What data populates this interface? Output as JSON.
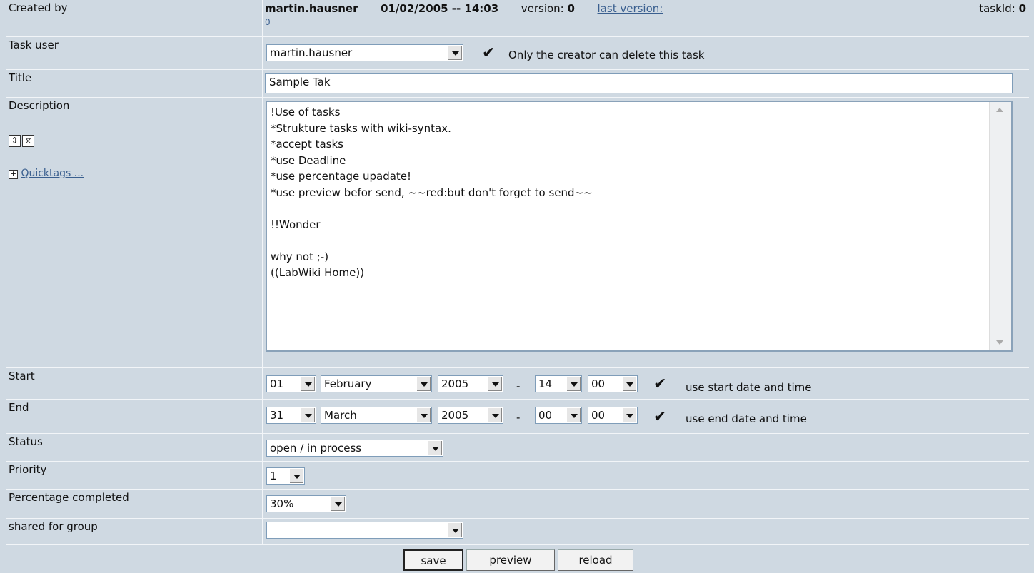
{
  "created": {
    "label": "Created by",
    "user": "martin.hausner",
    "datetime": "01/02/2005 -- 14:03",
    "version_label": "version:",
    "version_value": "0",
    "last_version_link": "last version:",
    "last_version_value": "0",
    "taskid_label": "taskId:",
    "taskid_value": "0"
  },
  "task_user": {
    "label": "Task user",
    "selected": "martin.hausner",
    "only_creator_label": "Only the creator can delete this task",
    "only_creator_checked": true
  },
  "title": {
    "label": "Title",
    "value": "Sample Tak"
  },
  "description": {
    "label": "Description",
    "quicktags_link": "Quicktags ...",
    "lines": [
      "!Use of tasks",
      "*Strukture tasks with wiki-syntax.",
      "*accept tasks",
      "*use Deadline",
      "*use percentage upadate!",
      "*use preview befor send, ~~red:but don't forget to send~~",
      "",
      "!!Wonder",
      "",
      "why not ;-)",
      "((LabWiki Home))"
    ]
  },
  "start": {
    "label": "Start",
    "day": "01",
    "month": "February",
    "year": "2005",
    "dash": "-",
    "hour": "14",
    "minute": "00",
    "use_label": "use start date and time",
    "checked": true
  },
  "end": {
    "label": "End",
    "day": "31",
    "month": "March",
    "year": "2005",
    "dash": "-",
    "hour": "00",
    "minute": "00",
    "use_label": "use end date and time",
    "checked": true
  },
  "status": {
    "label": "Status",
    "selected": "open / in process"
  },
  "priority": {
    "label": "Priority",
    "selected": "1"
  },
  "percentage": {
    "label": "Percentage completed",
    "selected": "30%"
  },
  "shared": {
    "label": "shared for group",
    "selected": ""
  },
  "buttons": {
    "save": "save",
    "preview": "preview",
    "reload": "reload"
  },
  "icons": {
    "dropdown": "chevron-down-icon",
    "check": "checkmark-icon",
    "expand": "plus-box-icon",
    "resize": "resize-icon",
    "hourglass": "hourglass-icon"
  }
}
